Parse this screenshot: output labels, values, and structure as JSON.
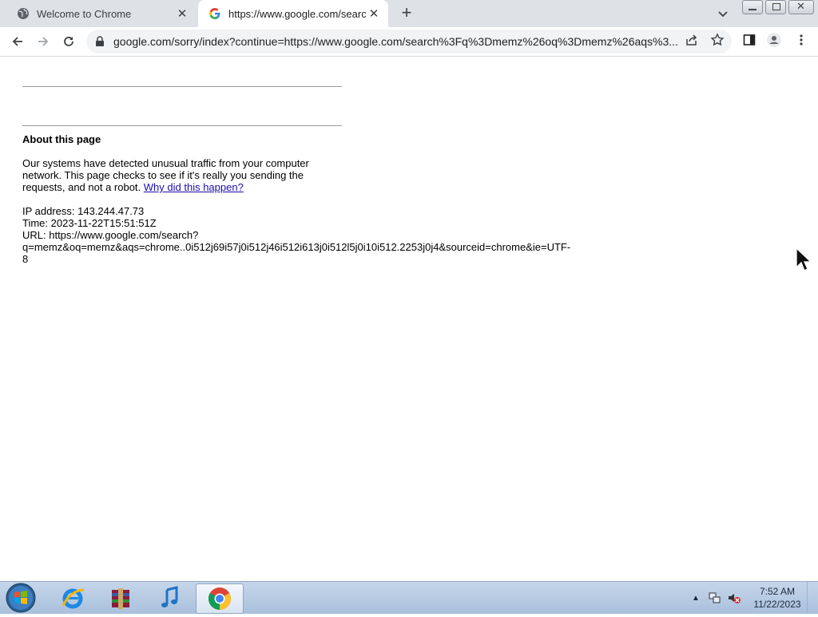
{
  "browser": {
    "tabs": [
      {
        "label": "Welcome to Chrome",
        "icon": "globe-icon"
      },
      {
        "label": "https://www.google.com/search?",
        "icon": "google-g-icon"
      }
    ],
    "address_bar": {
      "url": "google.com/sorry/index?continue=https://www.google.com/search%3Fq%3Dmemz%26oq%3Dmemz%26aqs%3..."
    }
  },
  "page": {
    "heading": "About this page",
    "paragraph_text": "Our systems have detected unusual traffic from your computer network. This page checks to see if it's really you sending the requests, and not a robot. ",
    "paragraph_link": "Why did this happen?",
    "ip_line": "IP address: 143.244.47.73",
    "time_line": "Time: 2023-11-22T15:51:51Z",
    "url_line_1": "URL: https://www.google.com/search?",
    "url_line_2": "q=memz&oq=memz&aqs=chrome..0i512j69i57j0i512j46i512i613j0i512l5j0i10i512.2253j0j4&sourceid=chrome&ie=UTF-",
    "url_line_3": "8"
  },
  "taskbar": {
    "apps": [
      "internet-explorer-icon",
      "winrar-icon",
      "itunes-icon",
      "chrome-icon"
    ],
    "clock_time": "7:52 AM",
    "clock_date": "11/22/2023"
  },
  "colors": {
    "tabstrip_bg": "#dee1e6",
    "link": "#1a0dab",
    "taskbar": "#b8cce4"
  }
}
